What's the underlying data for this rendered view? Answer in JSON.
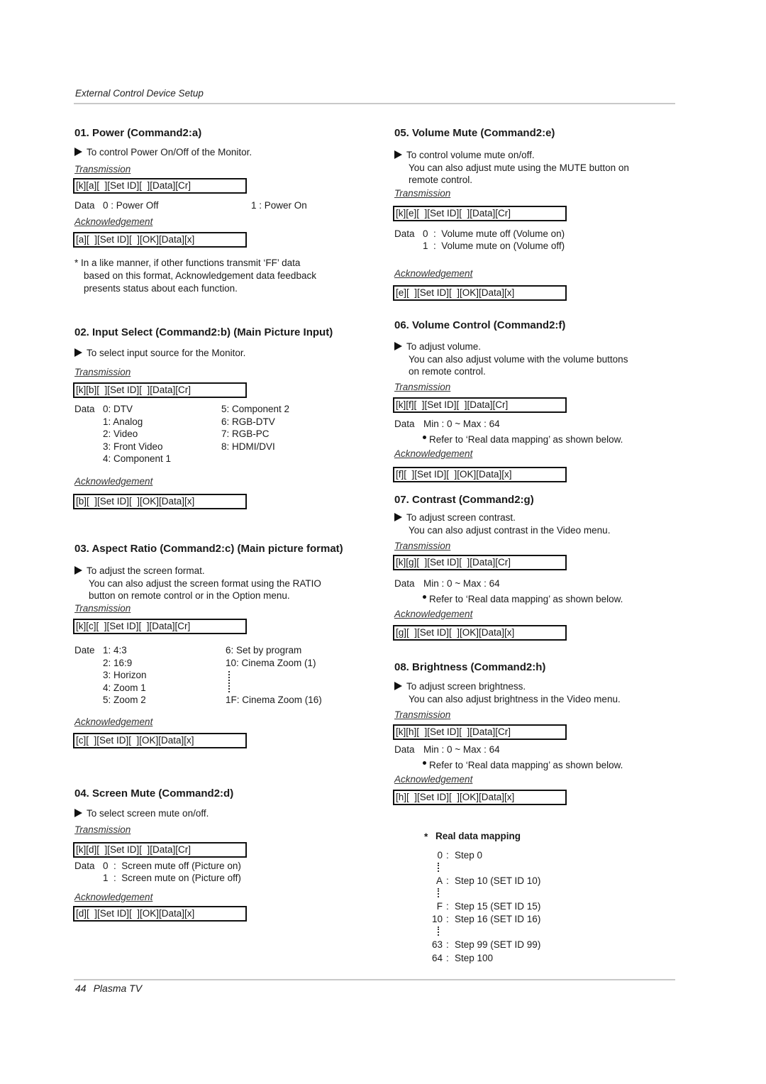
{
  "header": {
    "title": "External Control Device Setup"
  },
  "labels": {
    "transmission": "Transmission",
    "acknowledgement": "Acknowledgement"
  },
  "sections": {
    "s01": {
      "title": "01. Power (Command2:a)",
      "desc": [
        "To control Power On/Off of the Monitor."
      ],
      "transmission": "[k][a][  ][Set ID][  ][Data][Cr]",
      "data_label": "Data",
      "data_left": "0  : Power Off",
      "data_right": "1  : Power On",
      "ack": "[a][  ][Set ID][  ][OK][Data][x]",
      "note": [
        "* In a like manner, if other functions transmit ‘FF’ data",
        "based on this format, Acknowledgement data feedback",
        "presents status about each function."
      ]
    },
    "s02": {
      "title": "02. Input Select (Command2:b) (Main Picture Input)",
      "desc": [
        "To select input source for the Monitor."
      ],
      "transmission": "[k][b][  ][Set ID][  ][Data][Cr]",
      "data_label": "Data",
      "data_left": [
        "0: DTV",
        "1: Analog",
        "2: Video",
        "3: Front Video",
        "4: Component 1"
      ],
      "data_right": [
        "5: Component 2",
        "6: RGB-DTV",
        "7: RGB-PC",
        "8: HDMI/DVI"
      ],
      "ack": "[b][  ][Set ID][  ][OK][Data][x]"
    },
    "s03": {
      "title": "03. Aspect Ratio (Command2:c) (Main picture format)",
      "desc": [
        "To adjust the screen format.",
        "You can also adjust the screen format using the RATIO",
        "button on remote control or in the Option menu."
      ],
      "transmission": "[k][c][  ][Set ID][  ][Data][Cr]",
      "data_label": "Date",
      "data_left": [
        "1: 4:3",
        "2: 16:9",
        "3: Horizon",
        "4: Zoom 1",
        "5: Zoom 2"
      ],
      "data_right": [
        "6: Set by program",
        "10: Cinema Zoom (1)",
        "1F: Cinema Zoom (16)"
      ],
      "ack": "[c][  ][Set ID][  ][OK][Data][x]"
    },
    "s04": {
      "title": "04. Screen Mute (Command2:d)",
      "desc": [
        "To select screen mute on/off."
      ],
      "transmission": "[k][d][  ][Set ID][  ][Data][Cr]",
      "data_label": "Data",
      "data_rows": [
        "0  :  Screen mute off (Picture on)",
        "1  :  Screen mute on (Picture off)"
      ],
      "ack": "[d][  ][Set ID][  ][OK][Data][x]"
    },
    "s05": {
      "title": "05. Volume Mute (Command2:e)",
      "desc": [
        "To control volume mute on/off.",
        "You can also adjust mute using the MUTE button on",
        "remote control."
      ],
      "transmission": "[k][e][  ][Set ID][  ][Data][Cr]",
      "data_label": "Data",
      "data_rows": [
        "0  :  Volume mute off (Volume on)",
        "1  :  Volume mute on (Volume off)"
      ],
      "ack": "[e][  ][Set ID][  ][OK][Data][x]"
    },
    "s06": {
      "title": "06. Volume Control (Command2:f)",
      "desc": [
        "To adjust volume.",
        "You can also adjust volume with the volume buttons",
        "on remote control."
      ],
      "transmission": "[k][f][  ][Set ID][  ][Data][Cr]",
      "data_label": "Data",
      "data_range": "Min : 0 ~ Max : 64",
      "data_note": "Refer to ‘Real data mapping’ as shown below.",
      "ack": "[f][  ][Set ID][  ][OK][Data][x]"
    },
    "s07": {
      "title": "07. Contrast (Command2:g)",
      "desc": [
        "To adjust screen contrast.",
        "You can also adjust contrast in the Video menu."
      ],
      "transmission": "[k][g][  ][Set ID][  ][Data][Cr]",
      "data_label": "Data",
      "data_range": "Min : 0 ~ Max : 64",
      "data_note": "Refer to ‘Real data mapping’ as shown below.",
      "ack": "[g][  ][Set ID][  ][OK][Data][x]"
    },
    "s08": {
      "title": "08. Brightness (Command2:h)",
      "desc": [
        "To adjust screen brightness.",
        "You can also adjust brightness in the Video menu."
      ],
      "transmission": "[k][h][  ][Set ID][  ][Data][Cr]",
      "data_label": "Data",
      "data_range": "Min : 0 ~ Max : 64",
      "data_note": "Refer to ‘Real data mapping’ as shown below.",
      "ack": "[h][  ][Set ID][  ][OK][Data][x]"
    }
  },
  "mapping": {
    "title": "Real data mapping",
    "star": "*",
    "rows": [
      {
        "key": "0",
        "value": "Step 0"
      },
      {
        "key": "A",
        "value": "Step 10 (SET ID 10)"
      },
      {
        "key": "F",
        "value": "Step 15 (SET ID 15)"
      },
      {
        "key": "10",
        "value": "Step 16 (SET ID 16)"
      },
      {
        "key": "63",
        "value": "Step 99 (SET ID 99)"
      },
      {
        "key": "64",
        "value": "Step 100"
      }
    ],
    "sep": ":"
  },
  "footer": {
    "page_number": "44",
    "product": "Plasma TV"
  }
}
